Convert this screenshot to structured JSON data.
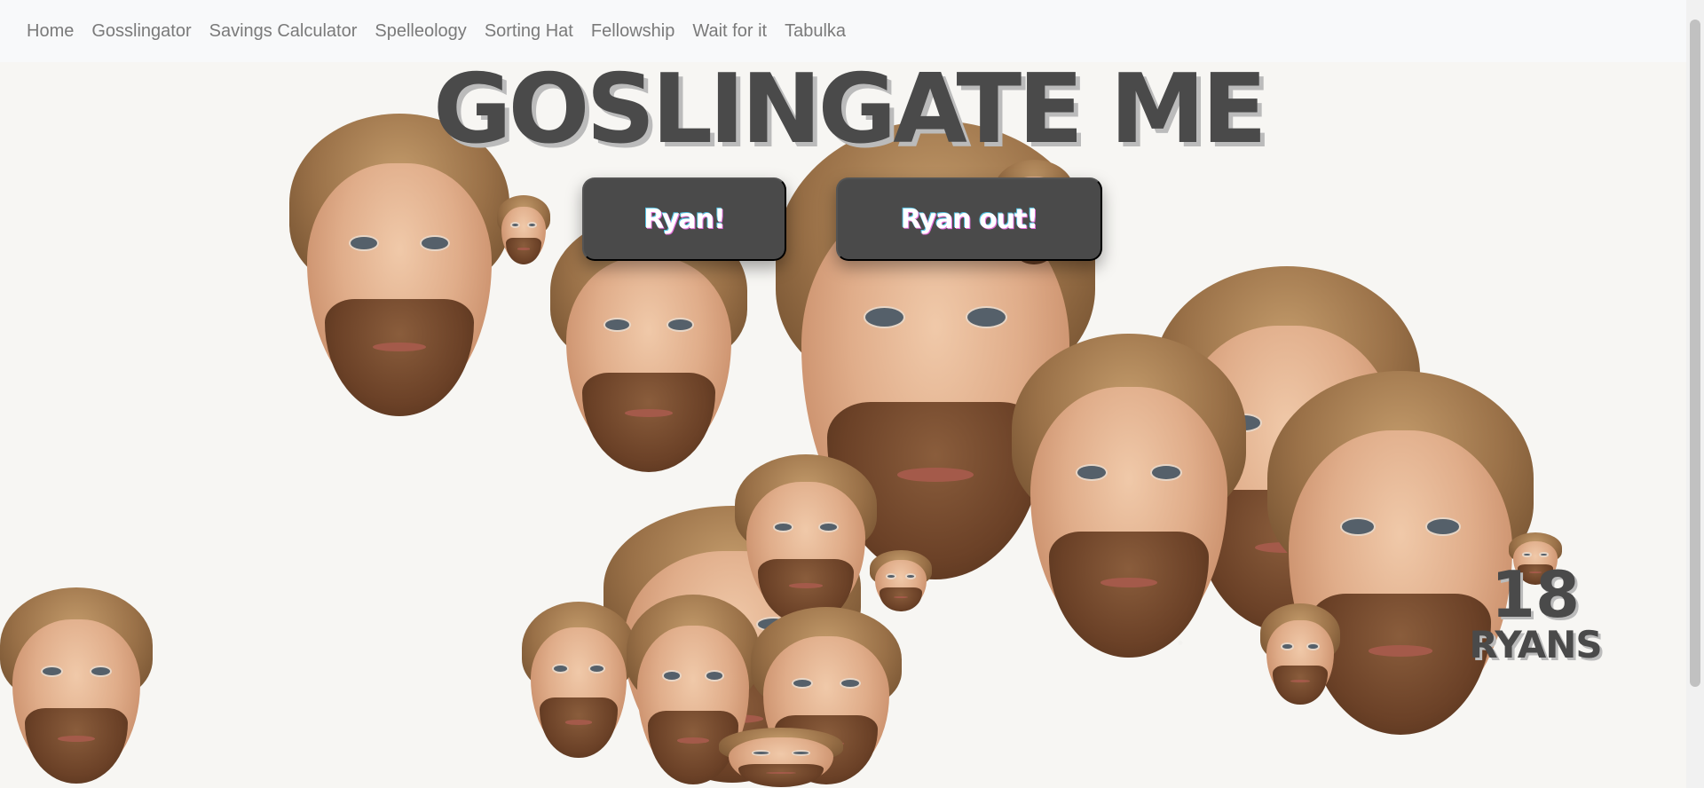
{
  "nav": {
    "items": [
      {
        "label": "Home"
      },
      {
        "label": "Gosslingator"
      },
      {
        "label": "Savings Calculator"
      },
      {
        "label": "Spelleology"
      },
      {
        "label": "Sorting Hat"
      },
      {
        "label": "Fellowship"
      },
      {
        "label": "Wait for it"
      },
      {
        "label": "Tabulka"
      }
    ]
  },
  "main": {
    "title": "GOSLINGATE ME",
    "add_button_label": "Ryan!",
    "remove_button_label": "Ryan out!",
    "counter_value": "18",
    "counter_label": "RYANS"
  },
  "heads_count": 18
}
